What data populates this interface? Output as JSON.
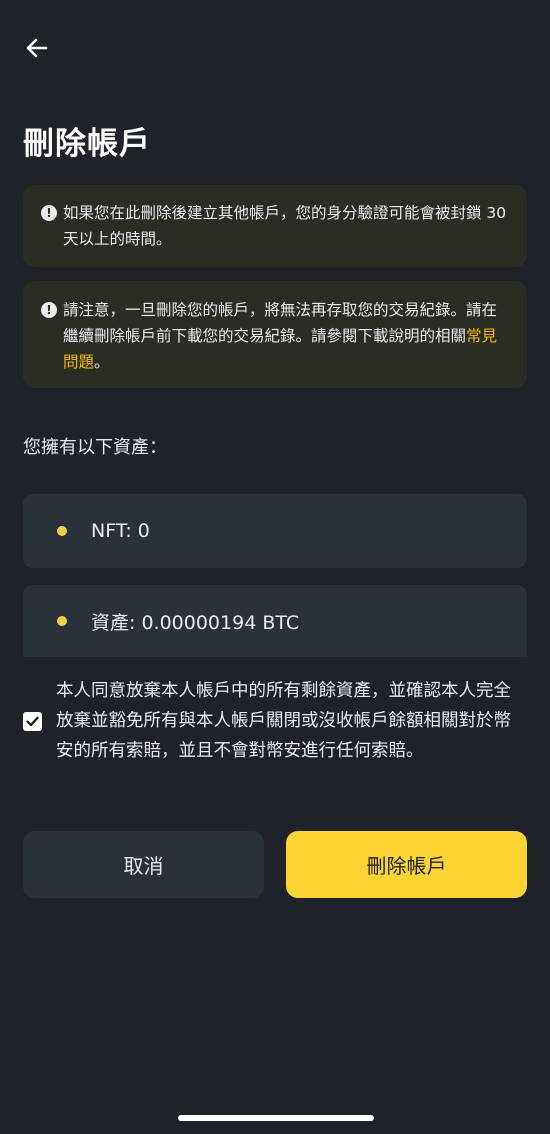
{
  "header": {
    "back_icon": "arrow-left-icon",
    "title": "刪除帳戶"
  },
  "notices": [
    {
      "icon": "exclamation-circle-icon",
      "text": "如果您在此刪除後建立其他帳戶，您的身分驗證可能會被封鎖 30 天以上的時間。"
    },
    {
      "icon": "exclamation-circle-icon",
      "text_before": "請注意，一旦刪除您的帳戶，將無法再存取您的交易紀錄。請在繼續刪除帳戶前下載您的交易紀錄。請參閱下載說明的相關",
      "link": "常見問題",
      "text_after": "。"
    }
  ],
  "assets": {
    "heading": "您擁有以下資產：",
    "items": [
      {
        "label": "NFT: 0"
      },
      {
        "label": "資產: 0.00000194 BTC"
      }
    ]
  },
  "agreement": {
    "checked": true,
    "text": "本人同意放棄本人帳戶中的所有剩餘資產，並確認本人完全放棄並豁免所有與本人帳戶關閉或沒收帳戶餘額相關對於幣安的所有索賠，並且不會對幣安進行任何索賠。"
  },
  "buttons": {
    "cancel_label": "取消",
    "delete_label": "刪除帳戶"
  },
  "colors": {
    "background": "#1f2329",
    "card": "#2b3139",
    "notice": "#2b2d24",
    "accent": "#fcd535",
    "link": "#f0b90b"
  }
}
